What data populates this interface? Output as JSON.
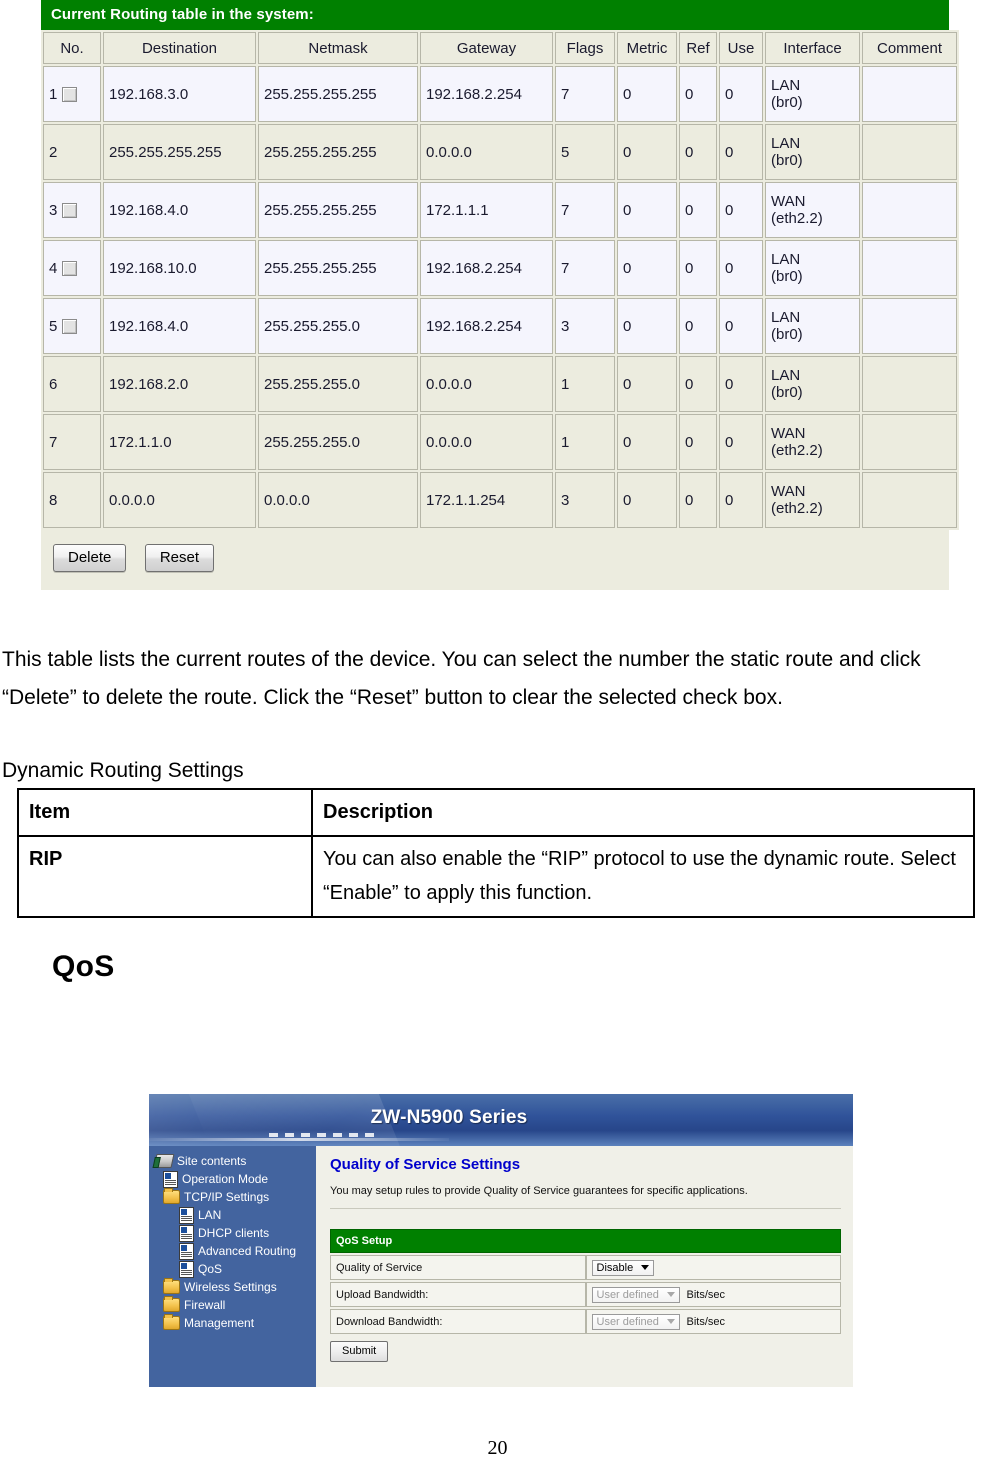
{
  "routing_screenshot": {
    "green_bar_title": "Current Routing table in the system:",
    "columns": [
      "No.",
      "Destination",
      "Netmask",
      "Gateway",
      "Flags",
      "Metric",
      "Ref",
      "Use",
      "Interface",
      "Comment"
    ],
    "rows": [
      {
        "no": "1",
        "checkbox": true,
        "destination": "192.168.3.0",
        "netmask": "255.255.255.255",
        "gateway": "192.168.2.254",
        "flags": "7",
        "metric": "0",
        "ref": "0",
        "use": "0",
        "interface_a": "LAN",
        "interface_b": "(br0)",
        "comment": ""
      },
      {
        "no": "2",
        "checkbox": false,
        "destination": "255.255.255.255",
        "netmask": "255.255.255.255",
        "gateway": "0.0.0.0",
        "flags": "5",
        "metric": "0",
        "ref": "0",
        "use": "0",
        "interface_a": "LAN",
        "interface_b": "(br0)",
        "comment": ""
      },
      {
        "no": "3",
        "checkbox": true,
        "destination": "192.168.4.0",
        "netmask": "255.255.255.255",
        "gateway": "172.1.1.1",
        "flags": "7",
        "metric": "0",
        "ref": "0",
        "use": "0",
        "interface_a": "WAN",
        "interface_b": "(eth2.2)",
        "comment": ""
      },
      {
        "no": "4",
        "checkbox": true,
        "destination": "192.168.10.0",
        "netmask": "255.255.255.255",
        "gateway": "192.168.2.254",
        "flags": "7",
        "metric": "0",
        "ref": "0",
        "use": "0",
        "interface_a": "LAN",
        "interface_b": "(br0)",
        "comment": ""
      },
      {
        "no": "5",
        "checkbox": true,
        "destination": "192.168.4.0",
        "netmask": "255.255.255.0",
        "gateway": "192.168.2.254",
        "flags": "3",
        "metric": "0",
        "ref": "0",
        "use": "0",
        "interface_a": "LAN",
        "interface_b": "(br0)",
        "comment": ""
      },
      {
        "no": "6",
        "checkbox": false,
        "destination": "192.168.2.0",
        "netmask": "255.255.255.0",
        "gateway": "0.0.0.0",
        "flags": "1",
        "metric": "0",
        "ref": "0",
        "use": "0",
        "interface_a": "LAN",
        "interface_b": "(br0)",
        "comment": ""
      },
      {
        "no": "7",
        "checkbox": false,
        "destination": "172.1.1.0",
        "netmask": "255.255.255.0",
        "gateway": "0.0.0.0",
        "flags": "1",
        "metric": "0",
        "ref": "0",
        "use": "0",
        "interface_a": "WAN",
        "interface_b": "(eth2.2)",
        "comment": ""
      },
      {
        "no": "8",
        "checkbox": false,
        "destination": "0.0.0.0",
        "netmask": "0.0.0.0",
        "gateway": "172.1.1.254",
        "flags": "3",
        "metric": "0",
        "ref": "0",
        "use": "0",
        "interface_a": "WAN",
        "interface_b": "(eth2.2)",
        "comment": ""
      }
    ],
    "delete_button": "Delete",
    "reset_button": "Reset"
  },
  "document": {
    "intro_paragraph": "This table lists the current routes of the device. You can select the number the static route and click “Delete” to delete the route. Click the “Reset” button to clear the selected check box.",
    "dynamic_routing_caption": "Dynamic Routing Settings",
    "desc_table": {
      "header_item": "Item",
      "header_description": "Description",
      "rows": [
        {
          "item": "RIP",
          "description": "You can also enable the “RIP” protocol to use the dynamic route. Select “Enable” to apply this function."
        }
      ]
    },
    "qos_heading": "QoS",
    "page_number": "20"
  },
  "qos_screenshot": {
    "banner_title": "ZW-N5900 Series",
    "sidebar": {
      "root_label": "Site contents",
      "items": [
        {
          "label": "Operation Mode",
          "icon": "page-icon",
          "level": 1
        },
        {
          "label": "TCP/IP Settings",
          "icon": "folder-icon",
          "level": 1
        },
        {
          "label": "LAN",
          "icon": "page-icon",
          "level": 2
        },
        {
          "label": "DHCP clients",
          "icon": "page-icon",
          "level": 2
        },
        {
          "label": "Advanced Routing",
          "icon": "page-icon",
          "level": 2
        },
        {
          "label": "QoS",
          "icon": "page-icon",
          "level": 2
        },
        {
          "label": "Wireless Settings",
          "icon": "folder-icon",
          "level": 1
        },
        {
          "label": "Firewall",
          "icon": "folder-icon",
          "level": 1
        },
        {
          "label": "Management",
          "icon": "folder-icon",
          "level": 1
        }
      ]
    },
    "main": {
      "title": "Quality of Service Settings",
      "description": "You may setup rules to provide Quality of Service guarantees for specific applications.",
      "setup_header": "QoS Setup",
      "fields": [
        {
          "label": "Quality of Service",
          "value": "Disable",
          "unit": "",
          "disabled": false
        },
        {
          "label": "Upload Bandwidth:",
          "value": "User defined",
          "unit": "Bits/sec",
          "disabled": true
        },
        {
          "label": "Download Bandwidth:",
          "value": "User defined",
          "unit": "Bits/sec",
          "disabled": true
        }
      ],
      "submit_label": "Submit"
    }
  },
  "colors": {
    "green_header": "#008000",
    "banner_blue": "#30539a",
    "sidebar_blue": "#43649f",
    "heading_blue": "#0000cc",
    "row_light": "#f5f5fd",
    "row_beige": "#ececdf"
  }
}
